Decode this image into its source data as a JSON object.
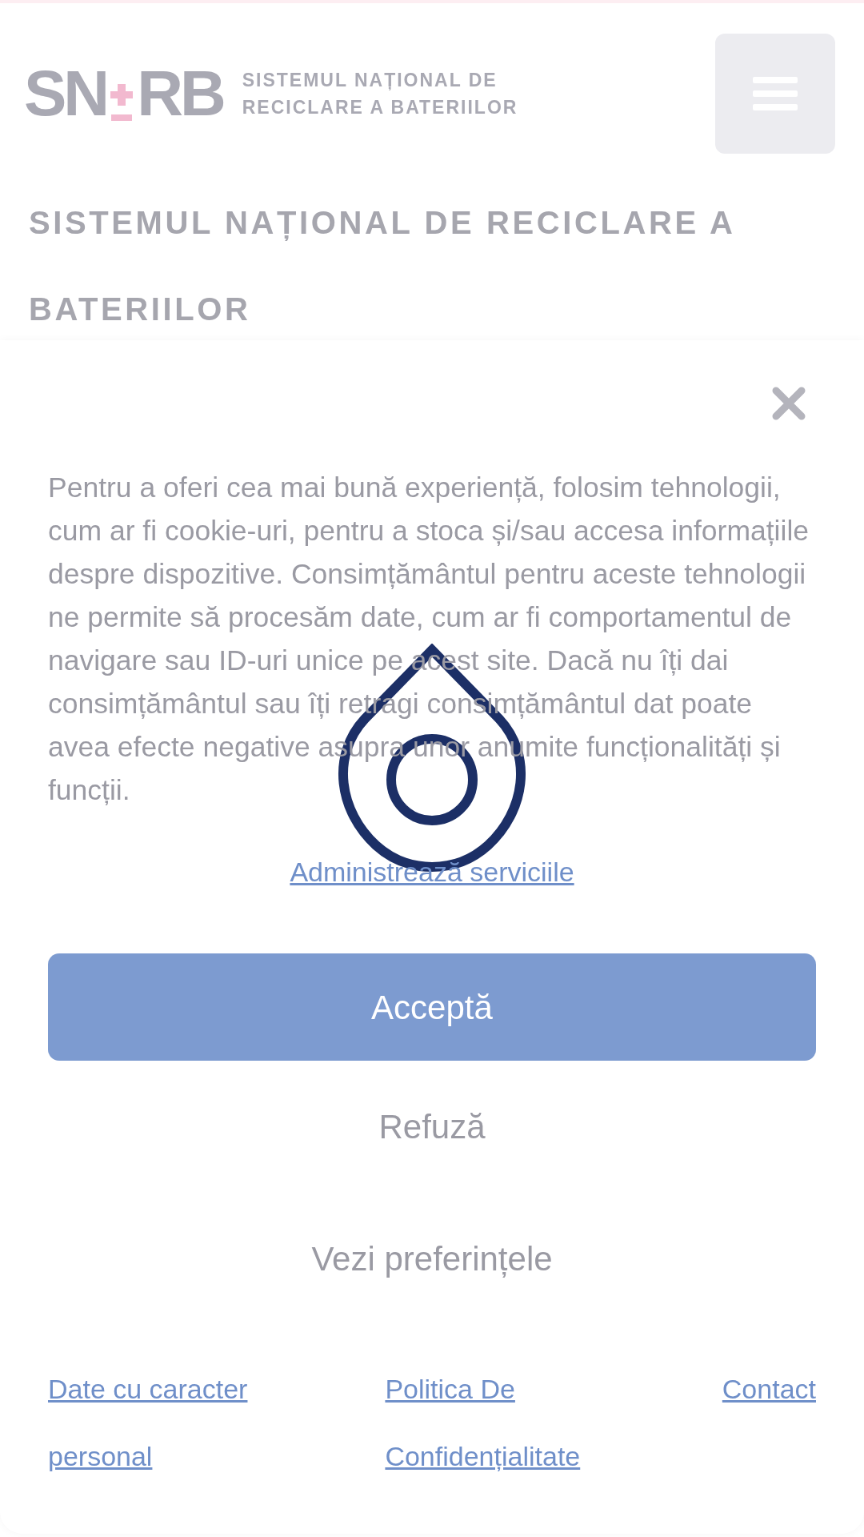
{
  "header": {
    "logo_mark": [
      "SN",
      "RB"
    ],
    "logo_text": [
      "SISTEMUL NAȚIONAL DE",
      "RECICLARE A BATERIILOR"
    ]
  },
  "page_title": "SISTEMUL NAȚIONAL DE RECICLARE A BATERIILOR",
  "consent_dialog": {
    "message": "Pentru a oferi cea mai bună experiență, folosim tehnologii, cum ar fi cookie-uri, pentru a stoca și/sau accesa informațiile despre dispozitive. Consimțământul pentru aceste tehnologii ne permite să procesăm date, cum ar fi comportamentul de navigare sau ID-uri unice pe acest site. Dacă nu îți dai consimțământul sau îți retragi consimțământul dat poate avea efecte negative asupra unor anumite funcționalități și funcții.",
    "manage_link": "Administrează serviciile",
    "buttons": [
      {
        "label": "Acceptă",
        "kind": "primary"
      },
      {
        "label": "Refuză",
        "kind": "plain"
      },
      {
        "label": "Vezi preferințele",
        "kind": "plain"
      }
    ],
    "footer_links": [
      "Date cu caracter personal",
      "Politica De Confidențialitate",
      "Contact"
    ]
  },
  "loading": true
}
